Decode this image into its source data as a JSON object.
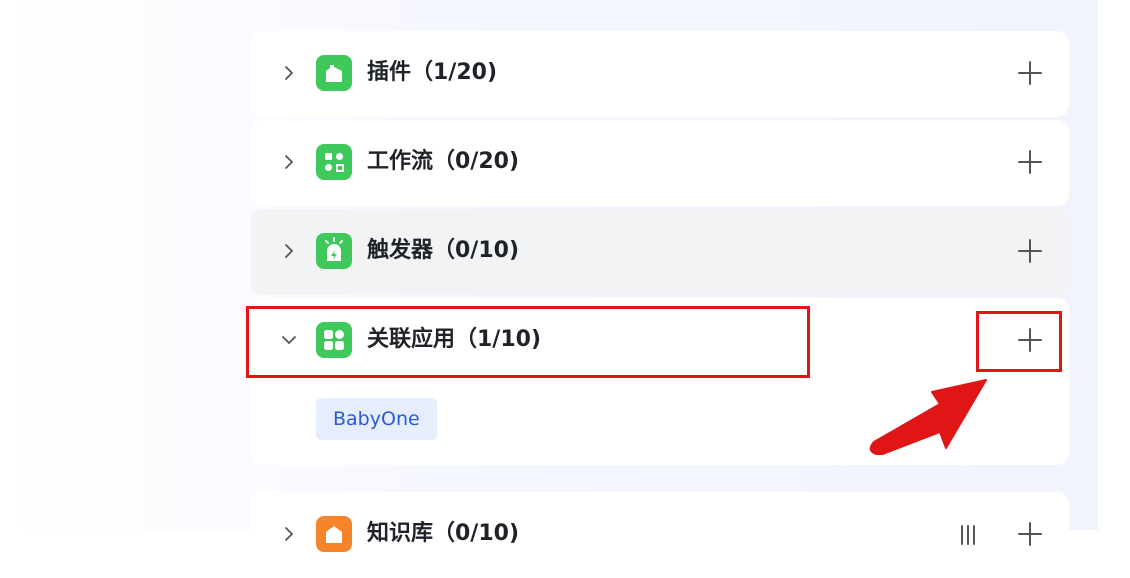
{
  "sections": [
    {
      "title": "插件（1/20)",
      "expanded": false,
      "icon": "plugin-icon",
      "color": "#3ec95a"
    },
    {
      "title": "工作流（0/20)",
      "expanded": false,
      "icon": "workflow-icon",
      "color": "#3ec95a"
    },
    {
      "title": "触发器（0/10)",
      "expanded": false,
      "icon": "trigger-icon",
      "color": "#3ec95a"
    },
    {
      "title": "关联应用（1/10)",
      "expanded": true,
      "icon": "apps-icon",
      "color": "#3ec95a"
    },
    {
      "title": "知识库（0/10)",
      "expanded": false,
      "icon": "knowledge-icon",
      "color": "#f5842a"
    }
  ],
  "linked_apps": [
    "BabyOne"
  ],
  "colors": {
    "accent_green": "#3ec95a",
    "annotation_red": "#e01616",
    "tag_bg": "#e6edfc",
    "tag_text": "#2b5bd7",
    "hover_row": "#f2f3f5"
  }
}
